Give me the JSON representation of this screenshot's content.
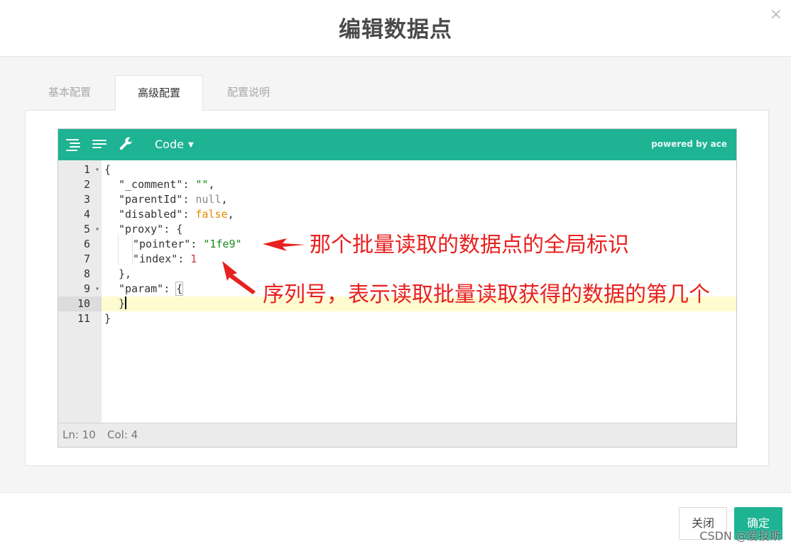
{
  "modal": {
    "title": "编辑数据点",
    "close_icon": "×"
  },
  "tabs": [
    {
      "label": "基本配置",
      "active": false
    },
    {
      "label": "高级配置",
      "active": true
    },
    {
      "label": "配置说明",
      "active": false
    }
  ],
  "editor": {
    "toolbar": {
      "icons": [
        "format-icon",
        "compact-icon",
        "repair-icon"
      ],
      "mode_label": "Code",
      "mode_caret": "▼",
      "powered_by": "powered by ace",
      "accent_color": "#1db393"
    },
    "lines": [
      {
        "num": "1",
        "fold": "▾",
        "text": "{"
      },
      {
        "num": "2",
        "fold": "",
        "key": "\"_comment\"",
        "sep": ": ",
        "val": "\"\"",
        "val_type": "str",
        "tail": ","
      },
      {
        "num": "3",
        "fold": "",
        "key": "\"parentId\"",
        "sep": ": ",
        "val": "null",
        "val_type": "null",
        "tail": ","
      },
      {
        "num": "4",
        "fold": "",
        "key": "\"disabled\"",
        "sep": ": ",
        "val": "false",
        "val_type": "bool",
        "tail": ","
      },
      {
        "num": "5",
        "fold": "▾",
        "key": "\"proxy\"",
        "sep": ": ",
        "val": "{",
        "val_type": "plain",
        "tail": ""
      },
      {
        "num": "6",
        "fold": "",
        "key": "\"pointer\"",
        "sep": ": ",
        "val": "\"1fe9\"",
        "val_type": "str",
        "tail": ""
      },
      {
        "num": "7",
        "fold": "",
        "key": "\"index\"",
        "sep": ": ",
        "val": "1",
        "val_type": "num",
        "tail": ""
      },
      {
        "num": "8",
        "fold": "",
        "text": "},"
      },
      {
        "num": "9",
        "fold": "▾",
        "key": "\"param\"",
        "sep": ": ",
        "val": "{",
        "val_type": "plain",
        "tail": ""
      },
      {
        "num": "10",
        "fold": "",
        "text": "}",
        "active": true
      },
      {
        "num": "11",
        "fold": "",
        "text": "}"
      }
    ],
    "status": {
      "ln": "Ln: 10",
      "col": "Col: 4"
    }
  },
  "annotations": {
    "pointer_note": "那个批量读取的数据点的全局标识",
    "index_note": "序列号，表示读取批量读取获得的数据的第几个",
    "color": "#e8201f"
  },
  "footer": {
    "close_label": "关闭",
    "ok_label": "确定"
  },
  "watermark": "CSDN @爱投斯"
}
